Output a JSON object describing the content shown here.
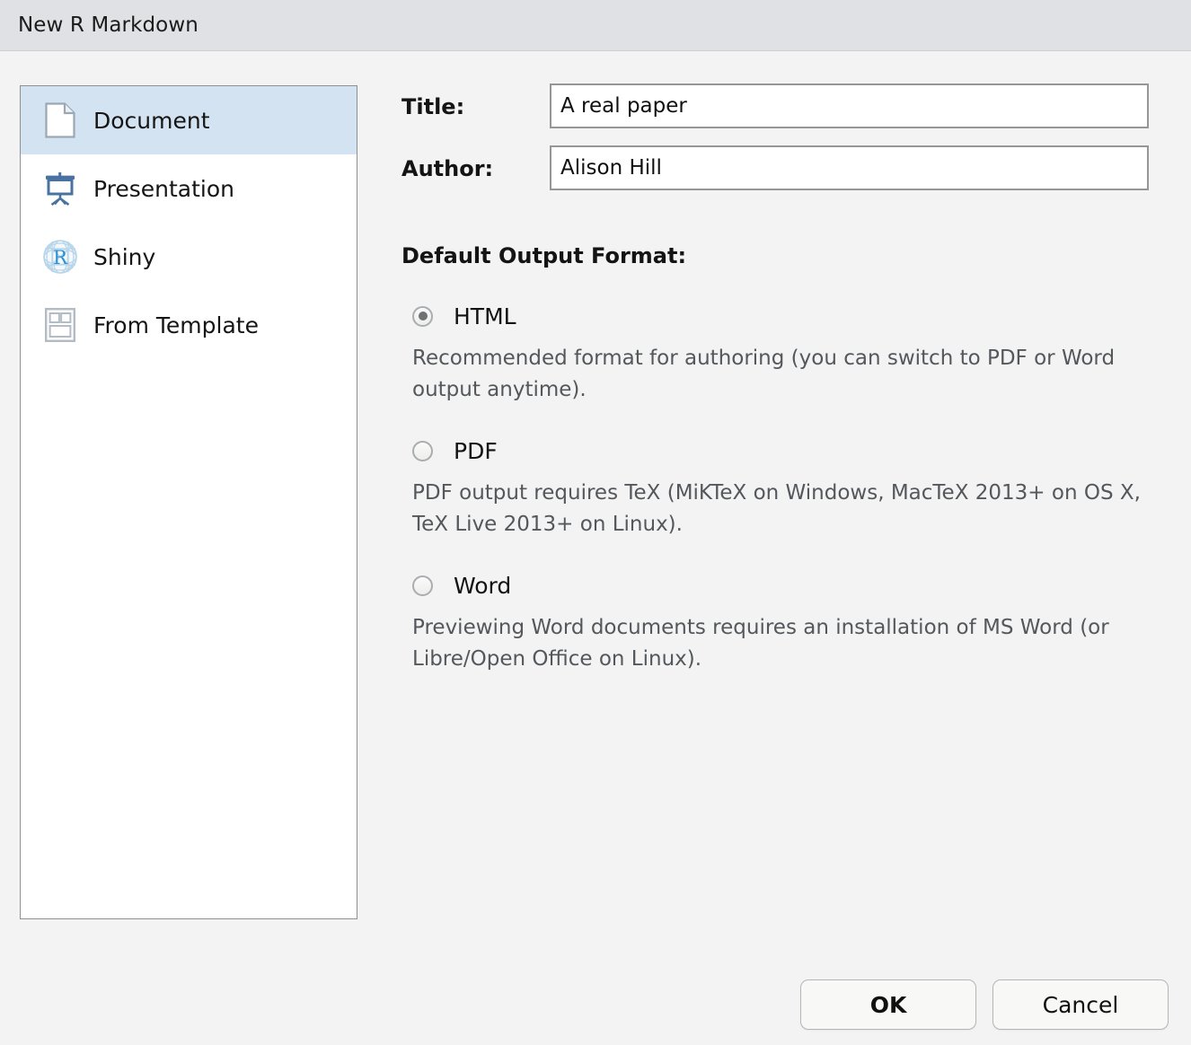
{
  "window": {
    "title": "New R Markdown"
  },
  "sidebar": {
    "items": [
      {
        "label": "Document",
        "icon": "document-page-icon",
        "selected": true
      },
      {
        "label": "Presentation",
        "icon": "presentation-screen-icon",
        "selected": false
      },
      {
        "label": "Shiny",
        "icon": "r-shiny-globe-icon",
        "selected": false
      },
      {
        "label": "From Template",
        "icon": "template-layout-icon",
        "selected": false
      }
    ]
  },
  "form": {
    "title_label": "Title:",
    "title_value": "A real paper",
    "title_placeholder": "",
    "author_label": "Author:",
    "author_value": "Alison Hill",
    "author_placeholder": ""
  },
  "output_format": {
    "heading": "Default Output Format:",
    "options": [
      {
        "label": "HTML",
        "selected": true,
        "description": "Recommended format for authoring (you can switch to PDF or Word output anytime)."
      },
      {
        "label": "PDF",
        "selected": false,
        "description": "PDF output requires TeX (MiKTeX on Windows, MacTeX 2013+ on OS X, TeX Live 2013+ on Linux)."
      },
      {
        "label": "Word",
        "selected": false,
        "description": "Previewing Word documents requires an installation of MS Word (or Libre/Open Office on Linux)."
      }
    ]
  },
  "buttons": {
    "ok": "OK",
    "cancel": "Cancel"
  },
  "colors": {
    "titlebar_bg": "#dfe1e4",
    "dialog_bg": "#f2f3f2",
    "selection_bg": "#d4e3f1",
    "icon_blue": "#4a72a0",
    "description_text": "#54585c"
  }
}
